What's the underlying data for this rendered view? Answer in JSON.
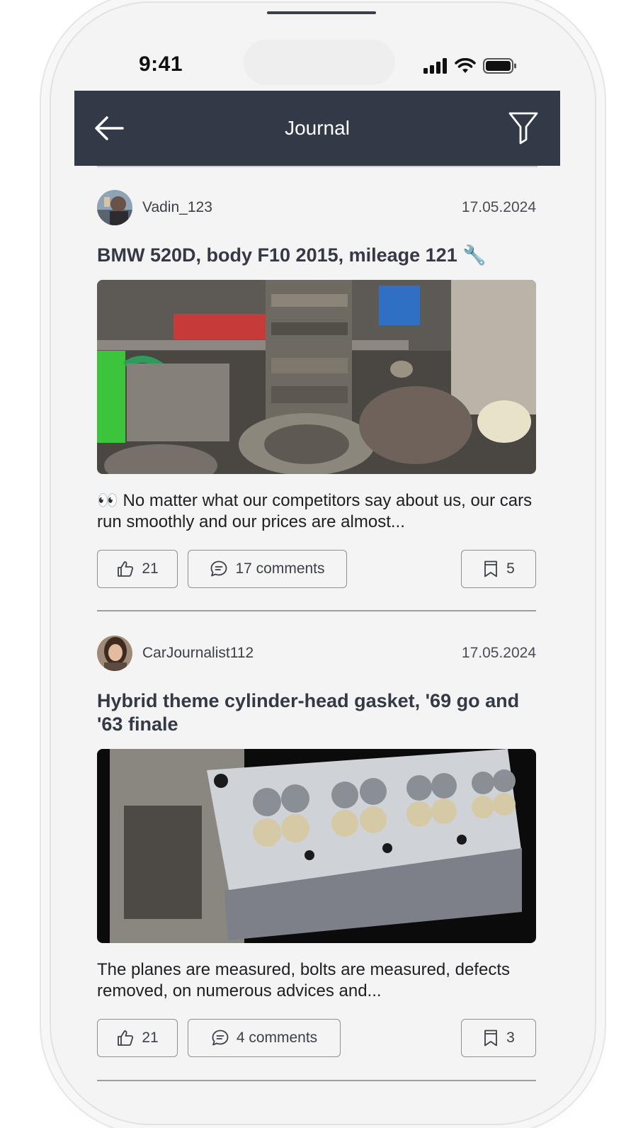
{
  "status_bar": {
    "time": "9:41"
  },
  "header": {
    "title": "Journal"
  },
  "posts": [
    {
      "author": "Vadin_123",
      "date": "17.05.2024",
      "title": "BMW 520D, body F10 2015, mileage 121 🔧",
      "excerpt": "👀 No matter what our competitors say about us, our cars run smoothly and our prices are almost...",
      "likes": "21",
      "comments": "17 comments",
      "bookmarks": "5"
    },
    {
      "author": "CarJournalist112",
      "date": "17.05.2024",
      "title": "Hybrid theme cylinder-head gasket, '69 go and '63 finale",
      "excerpt": "The planes are measured, bolts are measured, defects removed, on numerous advices and...",
      "likes": "21",
      "comments": "4 comments",
      "bookmarks": "3"
    }
  ],
  "icons": {
    "back": "arrow-left-icon",
    "filter": "filter-icon",
    "like": "thumbs-up-icon",
    "comment": "comment-icon",
    "bookmark": "bookmark-icon",
    "signal": "signal-icon",
    "wifi": "wifi-icon",
    "battery": "battery-icon"
  },
  "colors": {
    "header_bg": "#323a48",
    "page_bg": "#f4f4f5",
    "title_text": "#343945"
  }
}
